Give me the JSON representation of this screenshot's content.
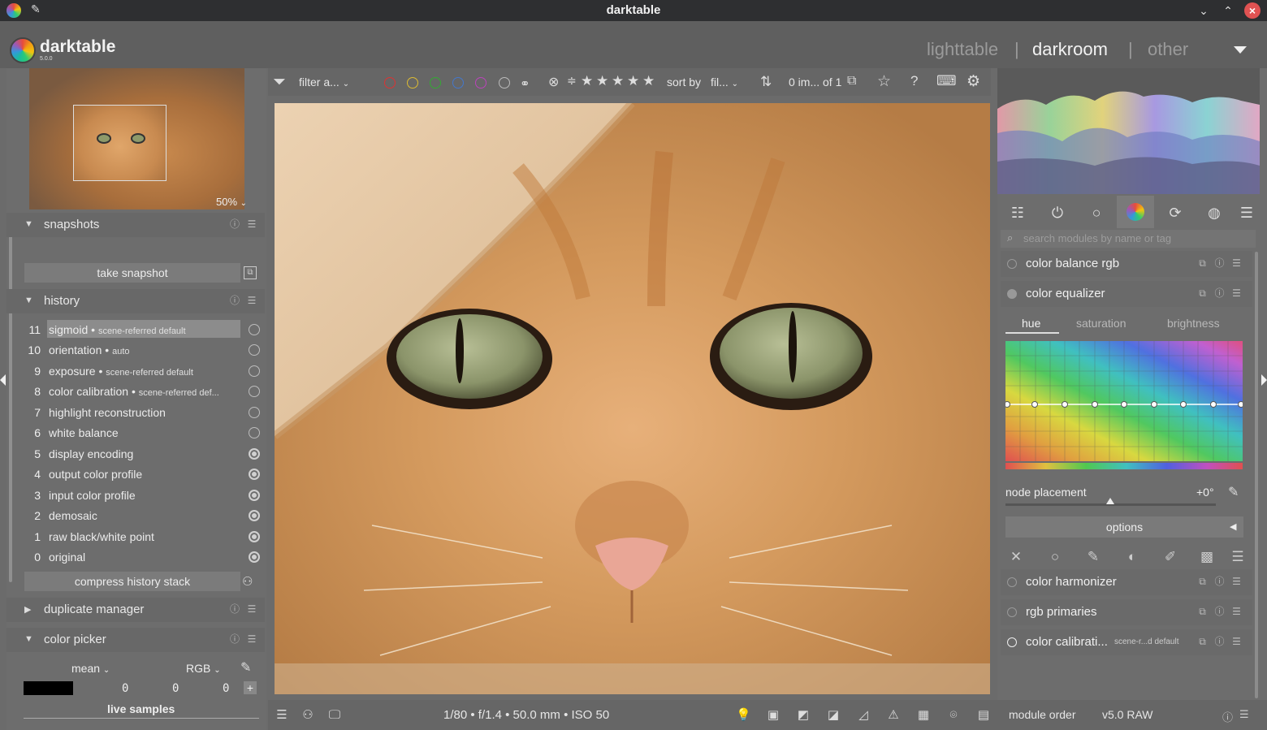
{
  "window": {
    "title": "darktable"
  },
  "app": {
    "name": "darktable",
    "version": "5.0.0"
  },
  "views": {
    "lighttable": "lighttable",
    "sep": "|",
    "darkroom": "darkroom",
    "other": "other"
  },
  "navigation": {
    "zoom": "50%"
  },
  "snapshots": {
    "title": "snapshots",
    "take_label": "take snapshot"
  },
  "history": {
    "title": "history",
    "items": [
      {
        "num": "11",
        "name": "sigmoid",
        "sub": "scene-referred default"
      },
      {
        "num": "10",
        "name": "orientation",
        "sub": "auto"
      },
      {
        "num": "9",
        "name": "exposure",
        "sub": "scene-referred default"
      },
      {
        "num": "8",
        "name": "color calibration",
        "sub": "scene-referred def..."
      },
      {
        "num": "7",
        "name": "highlight reconstruction",
        "sub": ""
      },
      {
        "num": "6",
        "name": "white balance",
        "sub": ""
      },
      {
        "num": "5",
        "name": "display encoding",
        "sub": ""
      },
      {
        "num": "4",
        "name": "output color profile",
        "sub": ""
      },
      {
        "num": "3",
        "name": "input color profile",
        "sub": ""
      },
      {
        "num": "2",
        "name": "demosaic",
        "sub": ""
      },
      {
        "num": "1",
        "name": "raw black/white point",
        "sub": ""
      },
      {
        "num": "0",
        "name": "original",
        "sub": ""
      }
    ],
    "compress_label": "compress history stack"
  },
  "duplicate_manager": {
    "title": "duplicate manager"
  },
  "color_picker": {
    "title": "color picker",
    "mode": "mean",
    "space": "RGB",
    "values": [
      "0",
      "0",
      "0"
    ],
    "live_samples": "live samples"
  },
  "filterbar": {
    "filter_label": "filter a...",
    "sort_label": "sort by",
    "sort_value": "fil...",
    "count": "0 im... of 1"
  },
  "bottombar": {
    "exif": "1/80 • f/1.4 • 50.0 mm • ISO 50"
  },
  "modules_panel": {
    "search_placeholder": "search modules by name or tag",
    "modules_top": [
      "color balance rgb",
      "color equalizer"
    ],
    "tabs": [
      "hue",
      "saturation",
      "brightness"
    ],
    "node_placement_label": "node placement",
    "node_placement_value": "+0°",
    "options_label": "options",
    "modules_bottom": [
      {
        "name": "color harmonizer",
        "sub": ""
      },
      {
        "name": "rgb primaries",
        "sub": ""
      },
      {
        "name": "color calibrati...",
        "sub": "scene-r...d default"
      }
    ]
  },
  "right_footer": {
    "module_order_label": "module order",
    "module_order_value": "v5.0 RAW"
  },
  "colors": {
    "accent": "#e05252",
    "panel": "#6d6d6d",
    "header": "#5f5f5f"
  }
}
